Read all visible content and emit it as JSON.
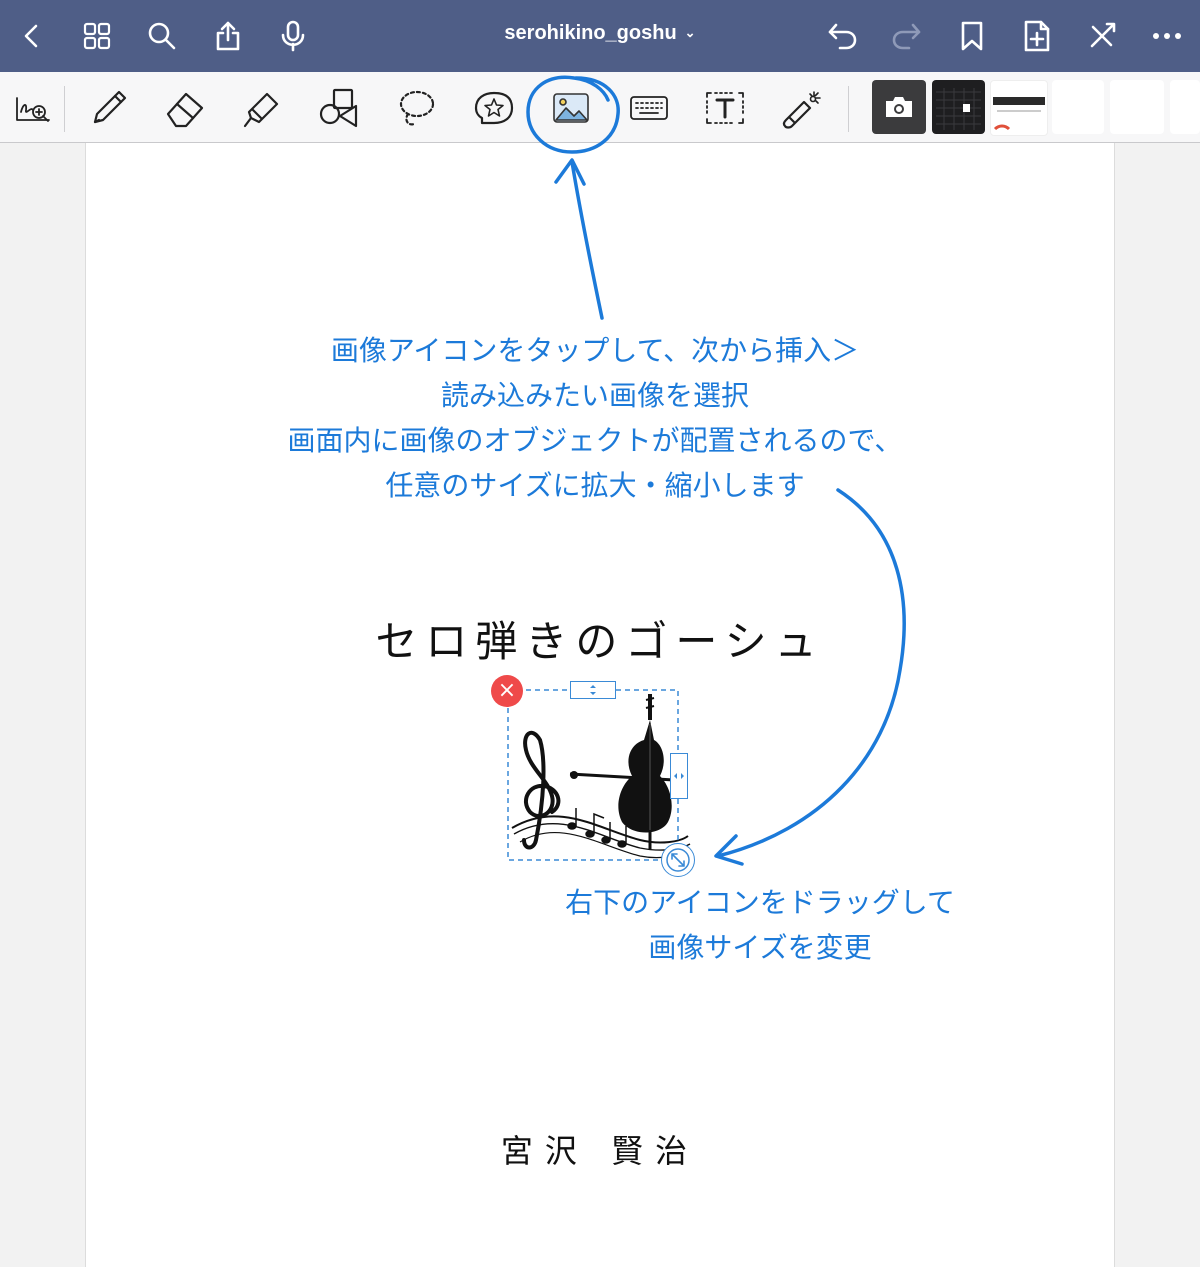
{
  "header": {
    "doc_title": "serohikino_goshu",
    "title_chevron": "⌄",
    "icons": [
      "back-icon",
      "grid-icon",
      "search-icon",
      "share-icon",
      "microphone-icon",
      "undo-icon",
      "redo-icon",
      "bookmark-icon",
      "add-page-icon",
      "close-tools-icon",
      "more-icon"
    ]
  },
  "toolbar": {
    "tools": [
      "zoom-window-icon",
      "pen-icon",
      "eraser-icon",
      "highlighter-icon",
      "shapes-icon",
      "lasso-icon",
      "sticker-icon",
      "image-icon",
      "keyboard-icon",
      "text-box-icon",
      "laser-pointer-icon",
      "camera-icon"
    ],
    "selected_tool": "image",
    "highlight_color": "#1c7ad9"
  },
  "page": {
    "book_title": "セロ弾きのゴーシュ",
    "author": "宮沢 賢治"
  },
  "annotation_top": {
    "lines": [
      "画像アイコンをタップして、次から挿入＞",
      "読み込みたい画像を選択",
      "画面内に画像のオブジェクトが配置されるので、",
      "任意のサイズに拡大・縮小します"
    ]
  },
  "annotation_bottom": {
    "lines": [
      "右下のアイコンをドラッグして",
      "画像サイズを変更"
    ]
  },
  "image_object": {
    "delete_symbol": "×",
    "handles": [
      "delete-handle",
      "top-resize-handle",
      "right-resize-handle",
      "corner-resize-handle"
    ]
  },
  "colors": {
    "header_bg": "#4f5e87",
    "annotation": "#1c7ad9",
    "delete_button": "#ef4a4a",
    "selection": "#3a8ad6"
  }
}
